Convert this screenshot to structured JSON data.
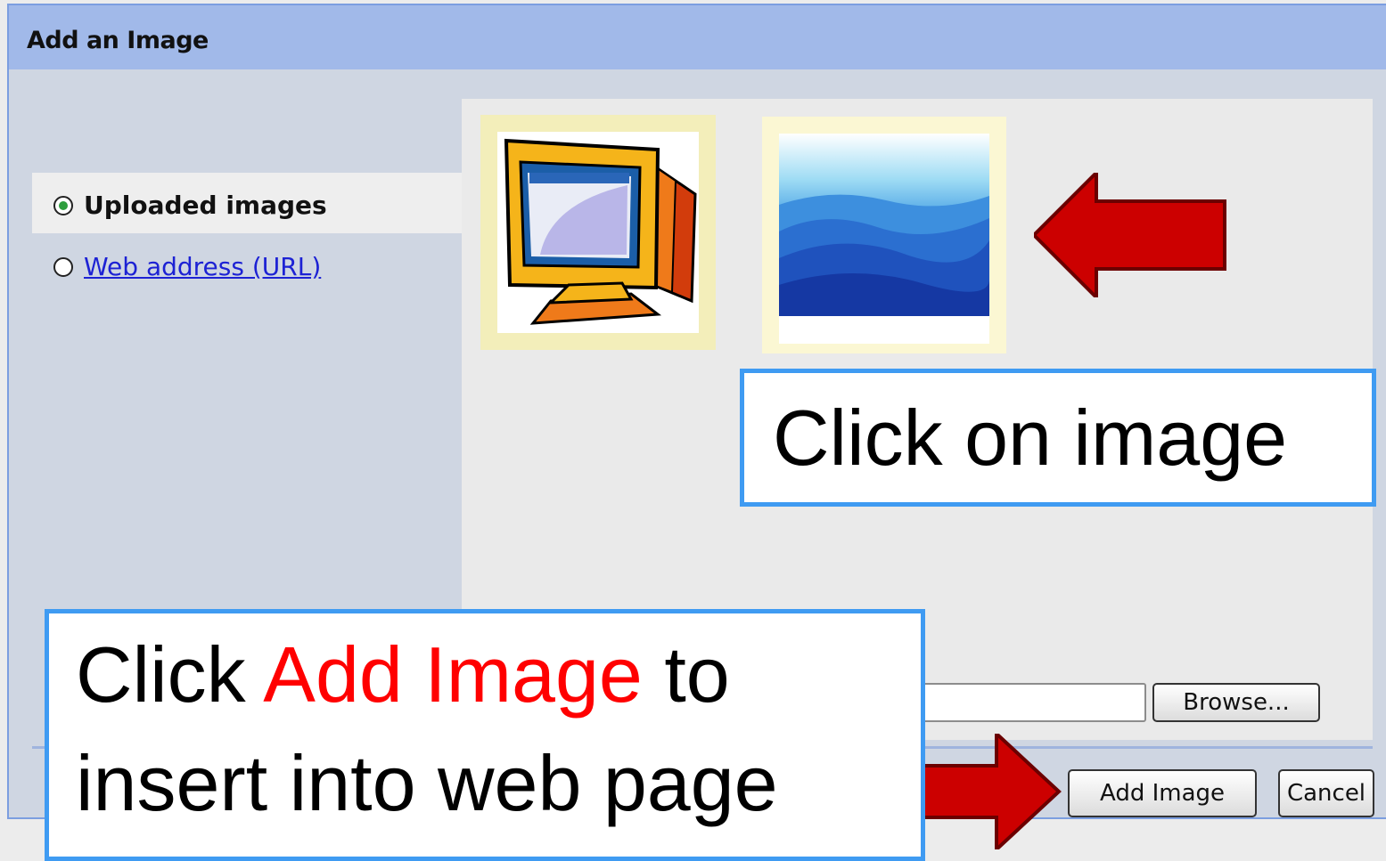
{
  "dialog": {
    "title": "Add an Image",
    "options": [
      {
        "label": "Uploaded images",
        "selected": true
      },
      {
        "label": "Web address (URL)",
        "selected": false
      }
    ],
    "thumbnails": [
      {
        "icon": "computer-monitor-clipart"
      },
      {
        "icon": "blue-mountains-photo"
      }
    ],
    "browse_label": "Browse...",
    "file_value": "",
    "add_image_label": "Add Image",
    "cancel_label": "Cancel"
  },
  "callouts": {
    "click_image": "Click on image",
    "line1_prefix": "Click ",
    "line1_highlight": "Add Image",
    "line1_suffix": " to",
    "line2": "insert into web page"
  },
  "colors": {
    "titlebar": "#a1b9e9",
    "callout_border": "#3f9bf2",
    "arrow_red": "#cc0000",
    "highlight_red": "#ff0000"
  }
}
